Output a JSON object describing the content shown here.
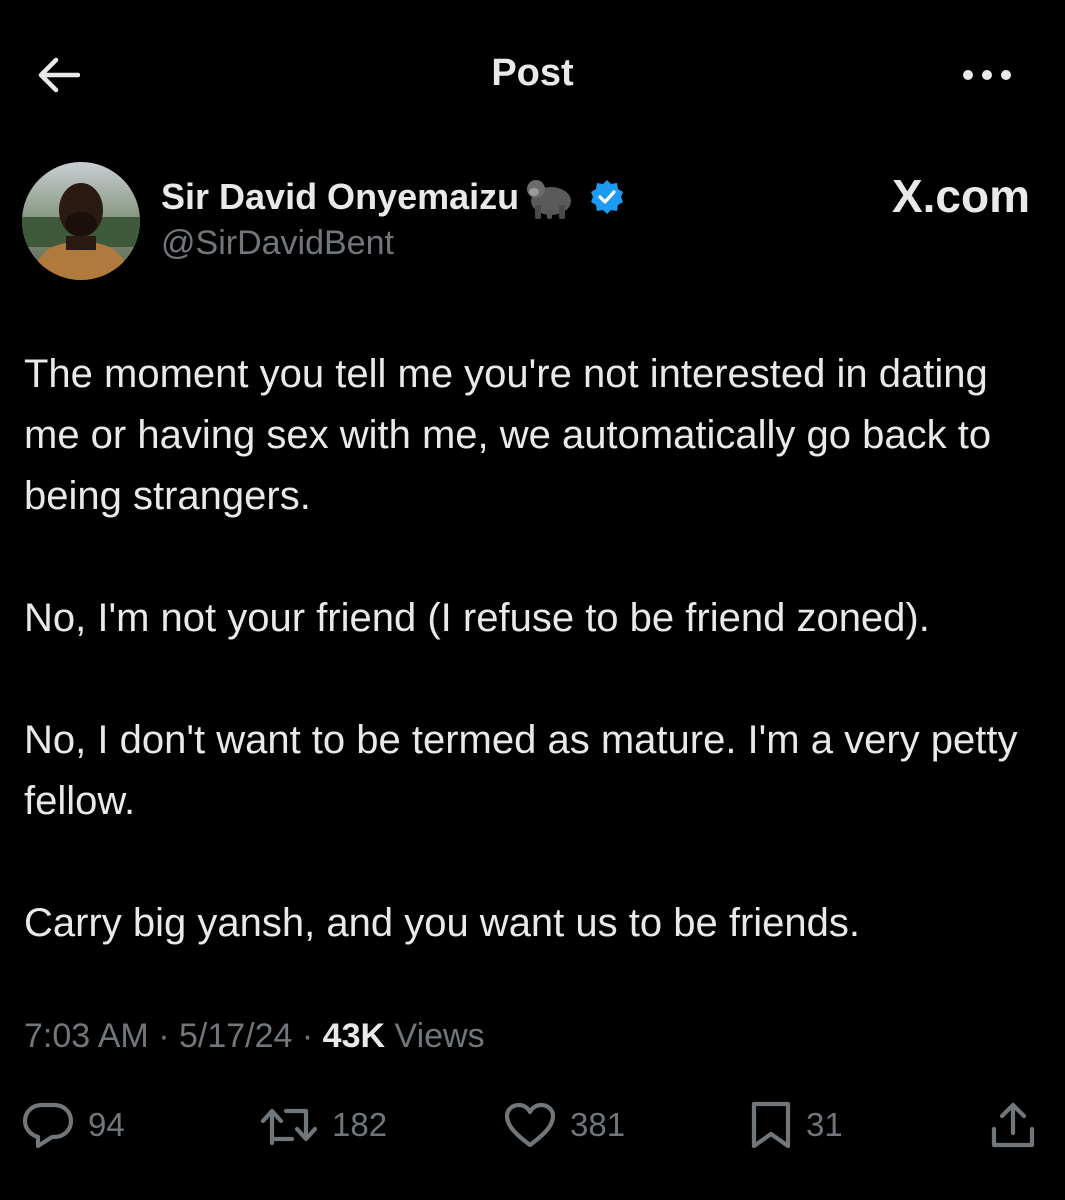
{
  "header": {
    "title": "Post",
    "back_icon": "arrow-left-icon",
    "more_icon": "more-horizontal-icon"
  },
  "author": {
    "name": "Sir David Onyemaizu",
    "name_emoji_icon": "gorilla-emoji-icon",
    "verified_icon": "verified-badge-icon",
    "handle": "@SirDavidBent",
    "avatar": "avatar"
  },
  "watermark": "X.com",
  "post": {
    "paragraphs": [
      "The moment you tell me you're not interested in dating me or having sex with me, we automatically go back to being strangers.",
      "No, I'm not your friend (I refuse to be friend zoned).",
      "No, I don't want to be termed as mature. I'm a very petty fellow.",
      "Carry big yansh, and you want us to be friends."
    ]
  },
  "meta": {
    "time": "7:03 AM",
    "date": "5/17/24",
    "views_count": "43K",
    "views_label": "Views",
    "separator": "·"
  },
  "actions": {
    "reply": {
      "icon": "reply-icon",
      "count": "94"
    },
    "repost": {
      "icon": "repost-icon",
      "count": "182"
    },
    "like": {
      "icon": "heart-icon",
      "count": "381"
    },
    "bookmark": {
      "icon": "bookmark-icon",
      "count": "31"
    },
    "share": {
      "icon": "share-icon"
    }
  },
  "colors": {
    "background": "#000000",
    "primary_text": "#e7e9ea",
    "secondary_text": "#71767b",
    "verified_blue": "#1d9bf0"
  }
}
